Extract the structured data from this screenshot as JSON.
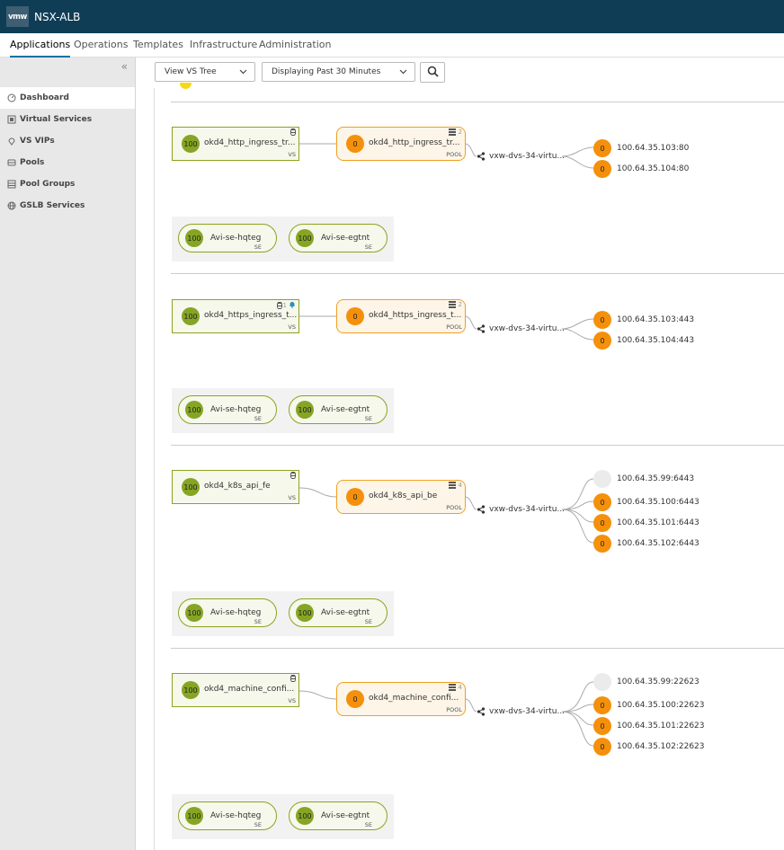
{
  "header": {
    "logo_text": "vmw",
    "app_title": "NSX-ALB"
  },
  "nav": {
    "tabs": [
      "Applications",
      "Operations",
      "Templates",
      "Infrastructure",
      "Administration"
    ],
    "active": "Applications"
  },
  "sidebar": {
    "collapse_icon": "double-chevron-left-icon",
    "items": [
      {
        "label": "Dashboard",
        "icon": "dashboard-icon",
        "active": true
      },
      {
        "label": "Virtual Services",
        "icon": "virtual-service-icon"
      },
      {
        "label": "VS VIPs",
        "icon": "location-pin-icon"
      },
      {
        "label": "Pools",
        "icon": "pool-icon"
      },
      {
        "label": "Pool Groups",
        "icon": "pool-group-icon"
      },
      {
        "label": "GSLB Services",
        "icon": "globe-icon"
      }
    ]
  },
  "toolbar": {
    "view_select": "View VS Tree",
    "time_select": "Displaying Past 30 Minutes",
    "search_icon": "search-icon"
  },
  "trees": [
    {
      "vs": {
        "score": "100",
        "name": "okd4_http_ingress_tr...",
        "type": "VS",
        "badge": ""
      },
      "pool": {
        "score": "0",
        "name": "okd4_http_ingress_tr...",
        "type": "POOL",
        "count": "2"
      },
      "network": "vxw-dvs-34-virtu...",
      "servers": [
        {
          "score": "0",
          "addr": "100.64.35.103:80",
          "state": "down"
        },
        {
          "score": "0",
          "addr": "100.64.35.104:80",
          "state": "down"
        }
      ],
      "ses": [
        {
          "score": "100",
          "name": "Avi-se-hqteg",
          "type": "SE"
        },
        {
          "score": "100",
          "name": "Avi-se-egtnt",
          "type": "SE"
        }
      ]
    },
    {
      "vs": {
        "score": "100",
        "name": "okd4_https_ingress_t...",
        "type": "VS",
        "badge": "1"
      },
      "pool": {
        "score": "0",
        "name": "okd4_https_ingress_t...",
        "type": "POOL",
        "count": "2"
      },
      "network": "vxw-dvs-34-virtu...",
      "servers": [
        {
          "score": "0",
          "addr": "100.64.35.103:443",
          "state": "down"
        },
        {
          "score": "0",
          "addr": "100.64.35.104:443",
          "state": "down"
        }
      ],
      "ses": [
        {
          "score": "100",
          "name": "Avi-se-hqteg",
          "type": "SE"
        },
        {
          "score": "100",
          "name": "Avi-se-egtnt",
          "type": "SE"
        }
      ]
    },
    {
      "vs": {
        "score": "100",
        "name": "okd4_k8s_api_fe",
        "type": "VS",
        "badge": ""
      },
      "pool": {
        "score": "0",
        "name": "okd4_k8s_api_be",
        "type": "POOL",
        "count": "4"
      },
      "network": "vxw-dvs-34-virtu...",
      "servers": [
        {
          "score": "",
          "addr": "100.64.35.99:6443",
          "state": "unknown"
        },
        {
          "score": "0",
          "addr": "100.64.35.100:6443",
          "state": "down"
        },
        {
          "score": "0",
          "addr": "100.64.35.101:6443",
          "state": "down"
        },
        {
          "score": "0",
          "addr": "100.64.35.102:6443",
          "state": "down"
        }
      ],
      "ses": [
        {
          "score": "100",
          "name": "Avi-se-hqteg",
          "type": "SE"
        },
        {
          "score": "100",
          "name": "Avi-se-egtnt",
          "type": "SE"
        }
      ]
    },
    {
      "vs": {
        "score": "100",
        "name": "okd4_machine_confi...",
        "type": "VS",
        "badge": ""
      },
      "pool": {
        "score": "0",
        "name": "okd4_machine_confi...",
        "type": "POOL",
        "count": "4"
      },
      "network": "vxw-dvs-34-virtu...",
      "servers": [
        {
          "score": "",
          "addr": "100.64.35.99:22623",
          "state": "unknown"
        },
        {
          "score": "0",
          "addr": "100.64.35.100:22623",
          "state": "down"
        },
        {
          "score": "0",
          "addr": "100.64.35.101:22623",
          "state": "down"
        },
        {
          "score": "0",
          "addr": "100.64.35.102:22623",
          "state": "down"
        }
      ],
      "ses": [
        {
          "score": "100",
          "name": "Avi-se-hqteg",
          "type": "SE"
        },
        {
          "score": "100",
          "name": "Avi-se-egtnt",
          "type": "SE"
        }
      ]
    }
  ],
  "colors": {
    "header_bg": "#0f3d55",
    "health_green": "#86a524",
    "health_orange": "#f4900b",
    "health_grey": "#ebebeb",
    "pool_border": "#f0a020",
    "vs_border": "#8aa41f",
    "link": "#0072a3"
  }
}
